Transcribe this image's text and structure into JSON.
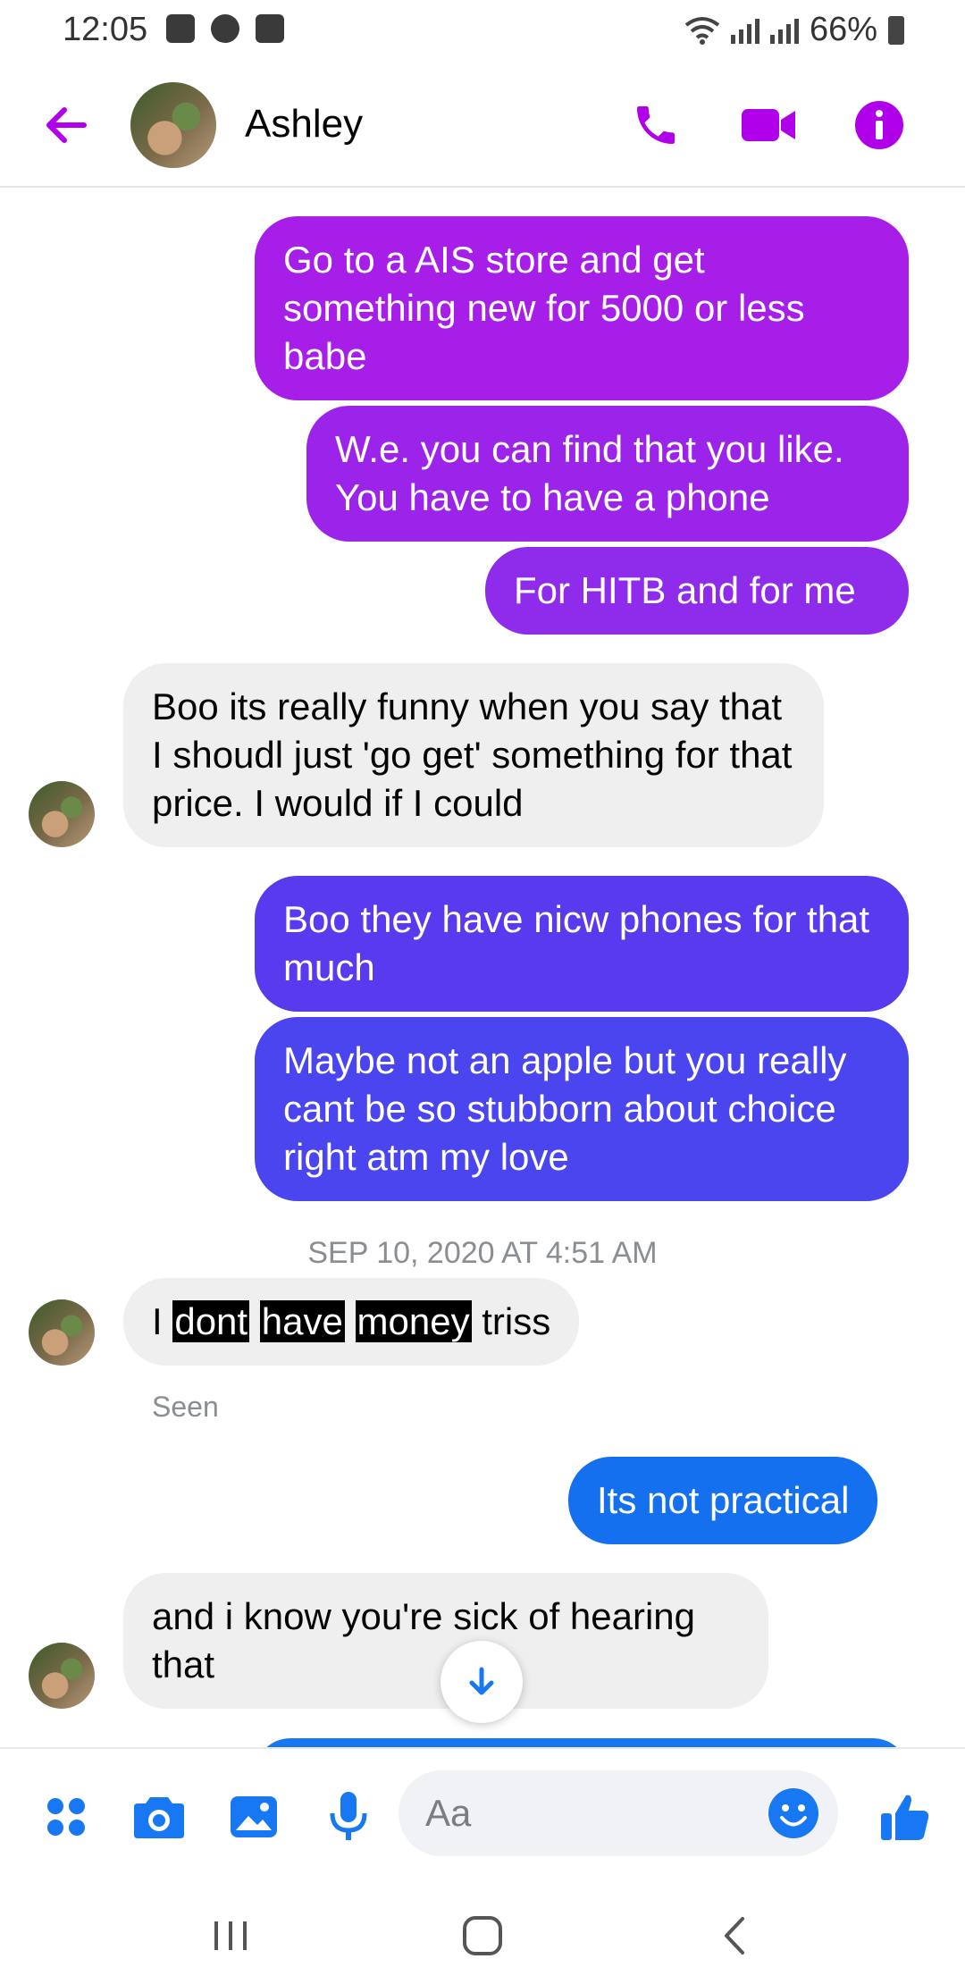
{
  "status_bar": {
    "time": "12:05",
    "battery": "66%"
  },
  "header": {
    "contact_name": "Ashley",
    "accent_color": "#b000ea"
  },
  "messages": [
    {
      "direction": "outgoing",
      "text": "Go to a AIS store and get something new for 5000 or less babe",
      "color": "#a61ee8"
    },
    {
      "direction": "outgoing",
      "text": "W.e. you can find that you like. You have to have a phone",
      "color": "#9c24ea"
    },
    {
      "direction": "outgoing",
      "text": "For HITB and for me",
      "color": "#8f2cec"
    },
    {
      "direction": "incoming",
      "text": "Boo its really funny when you say that I shoudl just 'go get' something for that price. I would if I could"
    },
    {
      "direction": "outgoing",
      "text": "Boo they have nicw phones for that much",
      "color": "#5a3aee"
    },
    {
      "direction": "outgoing",
      "text": "Maybe not an apple but you really cant be so stubborn about choice right atm my love",
      "color": "#4a45ef"
    },
    {
      "direction": "incoming",
      "text_parts": [
        "I",
        "dont",
        "have",
        "money",
        "triss"
      ],
      "highlighted_words": [
        "dont",
        "have",
        "money"
      ]
    },
    {
      "direction": "outgoing",
      "text": "Its not practical",
      "color": "#1470ef"
    },
    {
      "direction": "incoming",
      "text": "and i know you're sick of hearing that"
    }
  ],
  "timestamp": "SEP 10, 2020 AT 4:51 AM",
  "seen_label": "Seen",
  "composer": {
    "placeholder": "Aa",
    "icon_color": "#1877f2",
    "icons": [
      "apps-icon",
      "camera-icon",
      "gallery-icon",
      "microphone-icon",
      "emoji-icon",
      "thumbs-up-icon"
    ]
  },
  "nav_bar": {
    "icons": [
      "recents-icon",
      "home-icon",
      "back-nav-icon"
    ]
  }
}
